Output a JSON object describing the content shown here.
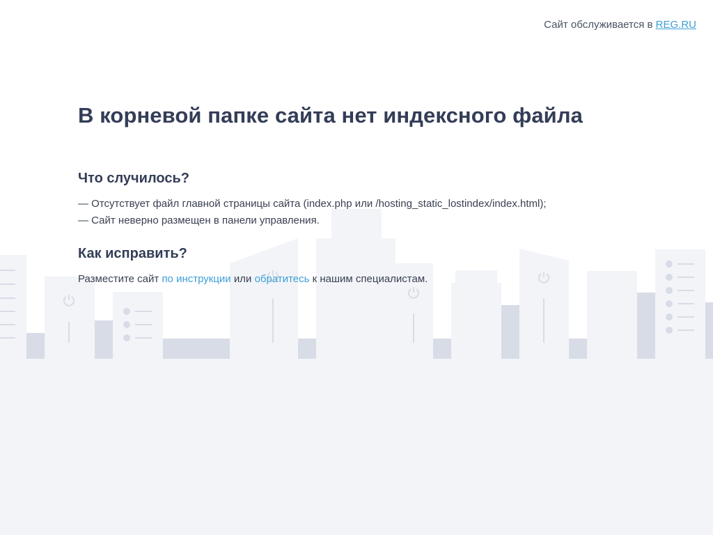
{
  "header": {
    "hosted_text": "Сайт обслуживается в",
    "hosted_link": "REG.RU"
  },
  "main": {
    "title": "В корневой папке сайта нет индексного файла",
    "what_happened": {
      "heading": "Что случилось?",
      "items": [
        "— Отсутствует файл главной страницы сайта (index.php или /hosting_static_lostindex/index.html);",
        "— Сайт неверно размещен в панели управления."
      ]
    },
    "how_to_fix": {
      "heading": "Как исправить?",
      "prefix": "Разместите сайт",
      "link1": "по инструкции",
      "middle": "или",
      "link2": "обратитесь",
      "suffix": "к нашим специалистам."
    }
  },
  "colors": {
    "link": "#3d9fd6",
    "heading": "#333d57",
    "background_city": "#f2f4f8",
    "city_accent": "#d8dce6"
  },
  "icons": [
    "power-icon",
    "list-bullets-icon"
  ]
}
